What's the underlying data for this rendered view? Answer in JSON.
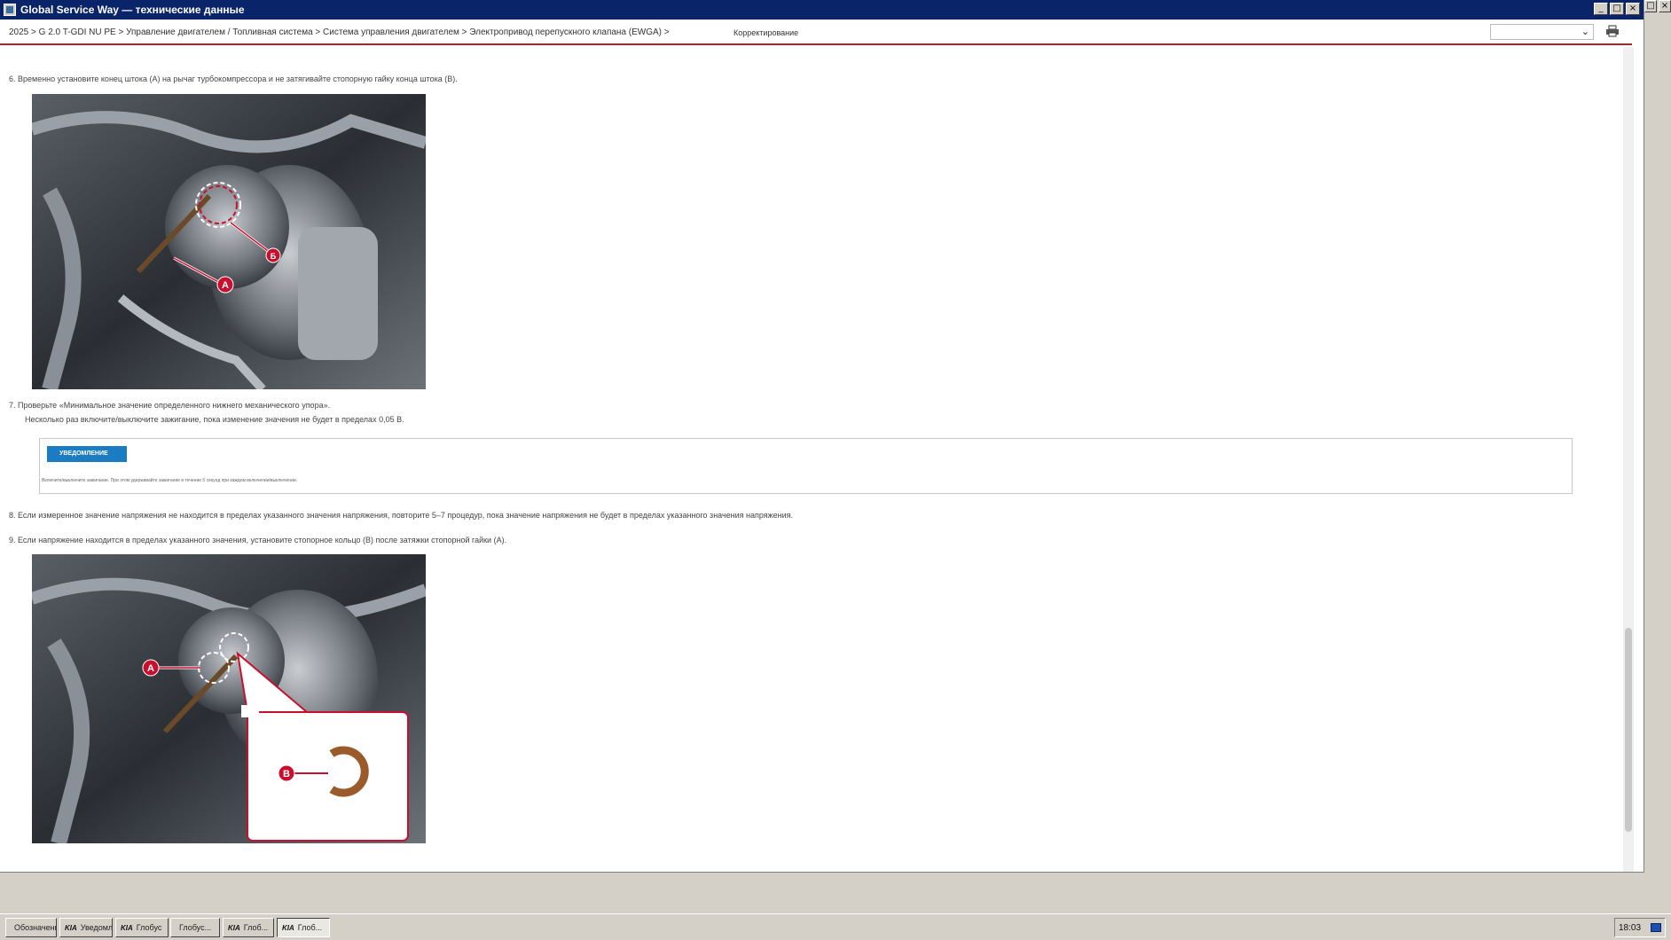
{
  "window": {
    "title": "Global Service Way — технические данные",
    "controls": [
      "_",
      "□",
      "×"
    ]
  },
  "outer_controls": [
    "□",
    "×"
  ],
  "header": {
    "breadcrumb": "2025 > G 2.0 T-GDI NU PE > Управление двигателем / Топливная система > Система управления двигателем > Электропривод перепускного клапана (EWGA) >",
    "correction_label": "Корректирование",
    "language_select_value": ""
  },
  "steps": {
    "step6": "6. Временно установите конец штока (A) на рычаг турбокомпрессора и не затягивайте стопорную гайку конца штока (B).",
    "step7": "7. Проверьте «Минимальное значение определенного нижнего механического упора».",
    "step7_sub": "Несколько раз включите/выключите зажигание, пока изменение значения не будет в пределах 0,05 В.",
    "step8": "8. Если измеренное значение напряжения не находится в пределах указанного значения напряжения, повторите 5–7 процедур, пока значение напряжения не будет в пределах указанного значения напряжения.",
    "step9": "9. Если напряжение находится в пределах указанного значения, установите стопорное кольцо (B) после затяжки стопорной гайки (A)."
  },
  "notice": {
    "badge": "УВЕДОМЛЕНИЕ",
    "text": "Включите/выключите зажигание. При этом удерживайте зажигание в течение 5 секунд при каждом включении/выключении."
  },
  "figure1": {
    "labels": {
      "a": "A",
      "b": "Б"
    }
  },
  "figure2": {
    "labels": {
      "a": "A",
      "b": "B"
    }
  },
  "taskbar": {
    "items": [
      {
        "prefix": "",
        "label": "Обозначения"
      },
      {
        "prefix": "KIA",
        "label": "Уведомлен..."
      },
      {
        "prefix": "KIA",
        "label": "Глобус"
      },
      {
        "prefix": "",
        "label": "Глобус..."
      },
      {
        "prefix": "KIA",
        "label": "Глоб..."
      },
      {
        "prefix": "KIA",
        "label": "Глоб..."
      }
    ],
    "clock": "18:03"
  },
  "colors": {
    "titlebar": "#0a246a",
    "accent_line": "#b22222",
    "notice_badge": "#1c7cc2",
    "callout_red": "#c8102e"
  }
}
